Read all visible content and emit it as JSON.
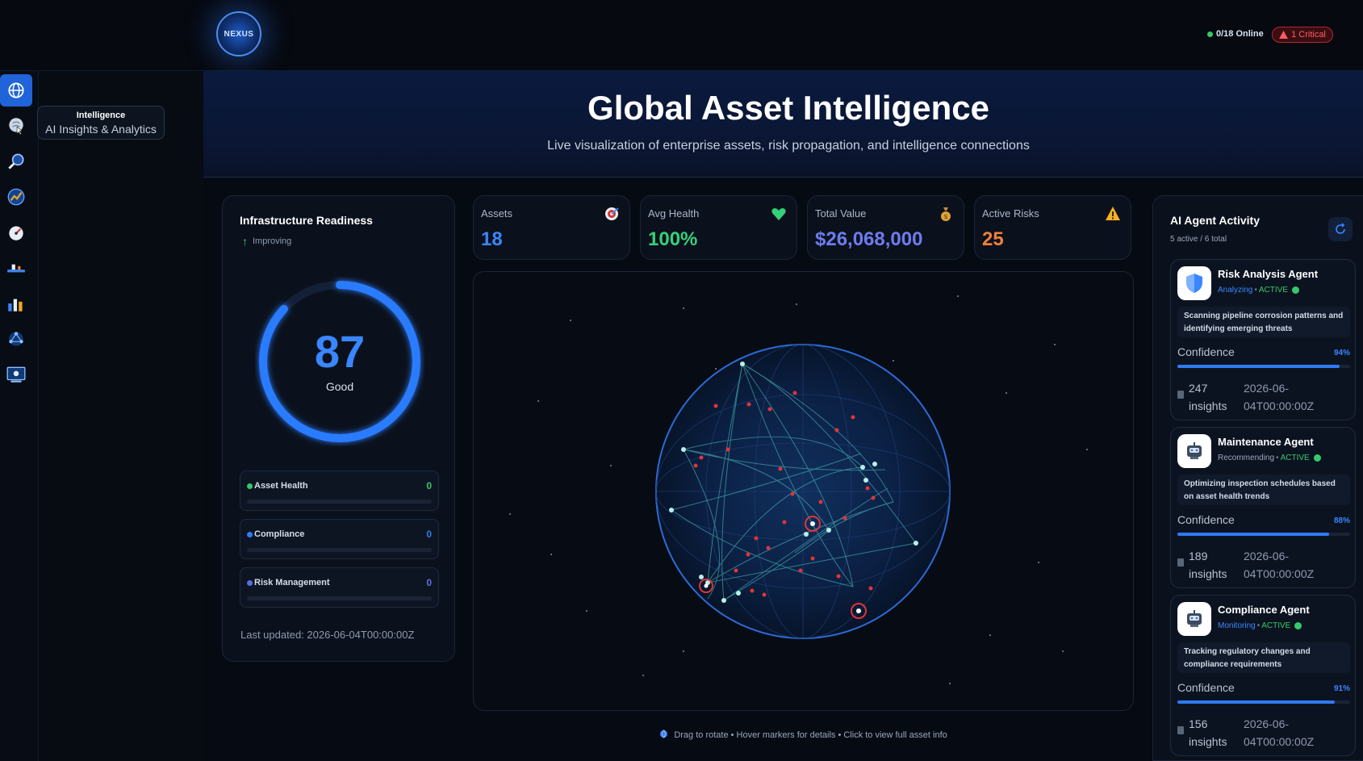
{
  "header": {
    "logo_text": "NEXUS",
    "online": "0/18 Online",
    "critical": "1 Critical",
    "colors": {
      "online": "#35c96a",
      "critical": "#ff5b63"
    }
  },
  "sidebar": {
    "items": [
      {
        "icon": "globe-icon",
        "active": true
      },
      {
        "icon": "brain-icon",
        "active": false
      },
      {
        "icon": "magnifier-icon",
        "active": false
      },
      {
        "icon": "chart-globe-icon",
        "active": false
      },
      {
        "icon": "gauge-icon",
        "active": false
      },
      {
        "icon": "pipeline-icon",
        "active": false
      },
      {
        "icon": "bar-chart-icon",
        "active": false
      },
      {
        "icon": "network-icon",
        "active": false
      },
      {
        "icon": "monitor-icon",
        "active": false
      }
    ],
    "tooltip": {
      "title": "Intelligence",
      "subtitle": "AI Insights & Analytics"
    }
  },
  "hero": {
    "title": "Global Asset Intelligence",
    "subtitle": "Live visualization of enterprise assets, risk propagation, and intelligence connections"
  },
  "infrastructure": {
    "title": "Infrastructure Readiness",
    "trend": "Improving",
    "score": "87",
    "score_fraction": 0.87,
    "score_label": "Good",
    "metrics": [
      {
        "name": "Asset Health",
        "value": "0",
        "color": "#35c96a"
      },
      {
        "name": "Compliance",
        "value": "0",
        "color": "#2f7bf5"
      },
      {
        "name": "Risk Management",
        "value": "0",
        "color": "#5a6fe0"
      }
    ],
    "last_updated": "Last updated: 2026-06-04T00:00:00Z"
  },
  "stats": [
    {
      "label": "Assets",
      "value": "18",
      "color": "#3a86ff",
      "icon": "target-icon"
    },
    {
      "label": "Avg Health",
      "value": "100%",
      "color": "#35d07a",
      "icon": "heart-icon"
    },
    {
      "label": "Total Value",
      "value": "$26,068,000",
      "color": "#6d7cf0",
      "icon": "money-bag-icon"
    },
    {
      "label": "Active Risks",
      "value": "25",
      "color": "#f0803a",
      "icon": "warning-icon"
    }
  ],
  "globe": {
    "hint": "Drag to rotate • Hover markers for details • Click to view full asset info"
  },
  "agents": {
    "title": "AI Agent Activity",
    "subtitle": "5 active / 6 total",
    "list": [
      {
        "name": "Risk Analysis Agent",
        "mode": "Analyzing",
        "mode_color": "#3a86ff",
        "status": "ACTIVE",
        "desc": "Scanning pipeline corrosion patterns and identifying emerging threats",
        "confidence_label": "Confidence",
        "confidence": "94%",
        "confidence_fraction": 0.94,
        "insights_count": "247",
        "insights_label": "insights",
        "date_1": "2026-06-",
        "date_2": "04T00:00:00Z",
        "icon": "shield-icon"
      },
      {
        "name": "Maintenance Agent",
        "mode": "Recommending",
        "mode_color": "#9aa7bb",
        "status": "ACTIVE",
        "desc": "Optimizing inspection schedules based on asset health trends",
        "confidence_label": "Confidence",
        "confidence": "88%",
        "confidence_fraction": 0.88,
        "insights_count": "189",
        "insights_label": "insights",
        "date_1": "2026-06-",
        "date_2": "04T00:00:00Z",
        "icon": "robot-icon"
      },
      {
        "name": "Compliance Agent",
        "mode": "Monitoring",
        "mode_color": "#3a86ff",
        "status": "ACTIVE",
        "desc": "Tracking regulatory changes and compliance requirements",
        "confidence_label": "Confidence",
        "confidence": "91%",
        "confidence_fraction": 0.91,
        "insights_count": "156",
        "insights_label": "insights",
        "date_1": "2026-06-",
        "date_2": "04T00:00:00Z",
        "icon": "robot-icon"
      }
    ]
  }
}
